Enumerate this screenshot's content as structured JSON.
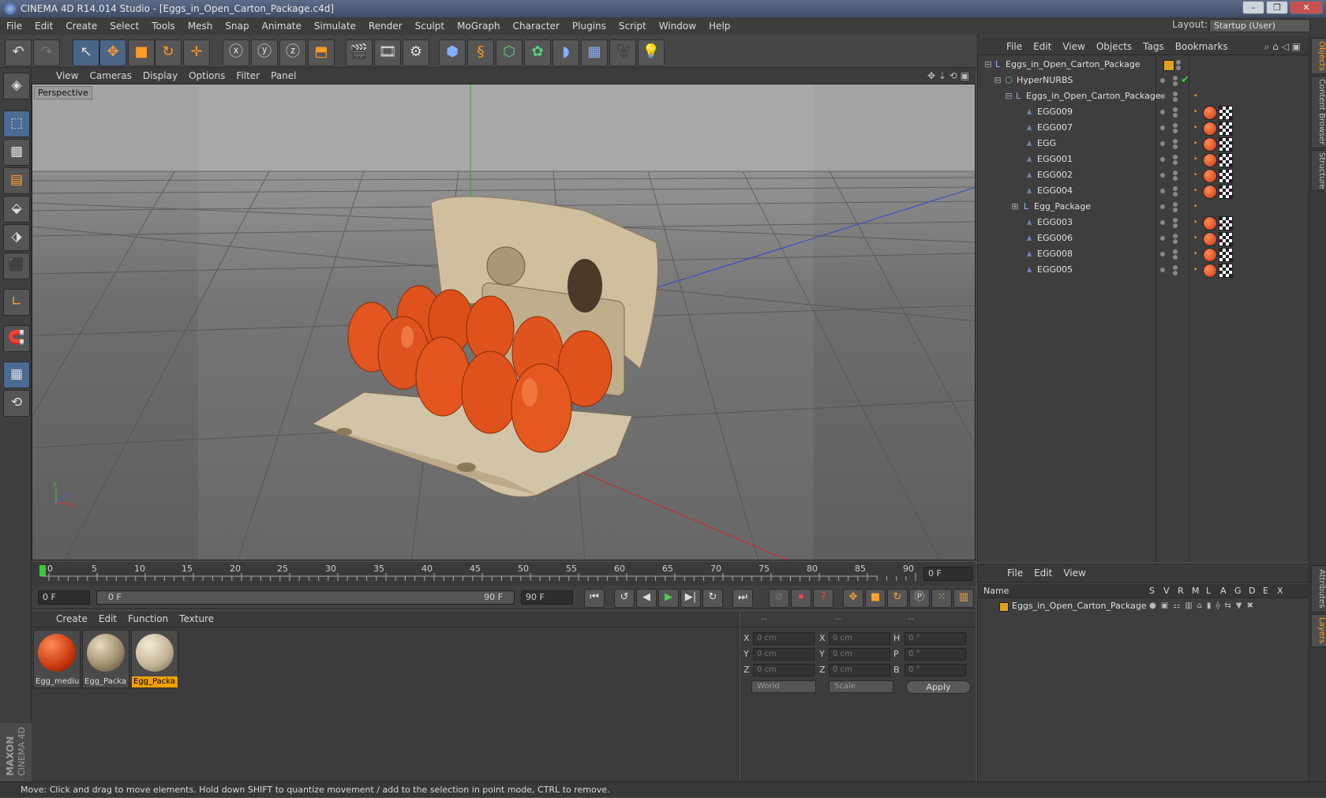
{
  "window": {
    "title": "CINEMA 4D R14.014 Studio - [Eggs_in_Open_Carton_Package.c4d]",
    "minimize": "–",
    "maximize": "❐",
    "close": "✕"
  },
  "menu": [
    "File",
    "Edit",
    "Create",
    "Select",
    "Tools",
    "Mesh",
    "Snap",
    "Animate",
    "Simulate",
    "Render",
    "Sculpt",
    "MoGraph",
    "Character",
    "Plugins",
    "Script",
    "Window",
    "Help"
  ],
  "layout": {
    "label": "Layout:",
    "value": "Startup (User)"
  },
  "viewport": {
    "menu": [
      "View",
      "Cameras",
      "Display",
      "Options",
      "Filter",
      "Panel"
    ],
    "label": "Perspective"
  },
  "timeline": {
    "ticks": [
      "0",
      "5",
      "10",
      "15",
      "20",
      "25",
      "30",
      "35",
      "40",
      "45",
      "50",
      "55",
      "60",
      "65",
      "70",
      "75",
      "80",
      "85",
      "90"
    ],
    "current_frame": "0 F",
    "start_field": "0 F",
    "range_start": "0 F",
    "range_end": "90 F",
    "end_field": "90 F"
  },
  "materials": {
    "menu": [
      "Create",
      "Edit",
      "Function",
      "Texture"
    ],
    "items": [
      {
        "name": "Egg_mediu",
        "selected": false
      },
      {
        "name": "Egg_Packa",
        "selected": false
      },
      {
        "name": "Egg_Packa",
        "selected": true
      }
    ]
  },
  "coords": {
    "headers": [
      "--",
      "--",
      "--"
    ],
    "rows": [
      {
        "l1": "X",
        "v1": "0 cm",
        "l2": "X",
        "v2": "0 cm",
        "l3": "H",
        "v3": "0 °"
      },
      {
        "l1": "Y",
        "v1": "0 cm",
        "l2": "Y",
        "v2": "0 cm",
        "l3": "P",
        "v3": "0 °"
      },
      {
        "l1": "Z",
        "v1": "0 cm",
        "l2": "Z",
        "v2": "0 cm",
        "l3": "B",
        "v3": "0 °"
      }
    ],
    "world": "World",
    "scale": "Scale",
    "apply": "Apply"
  },
  "objects": {
    "menu": [
      "File",
      "Edit",
      "View",
      "Objects",
      "Tags",
      "Bookmarks"
    ],
    "rows": [
      {
        "name": "Eggs_in_Open_Carton_Package",
        "indent": 0,
        "icon": "null"
      },
      {
        "name": "HyperNURBS",
        "indent": 1,
        "icon": "nurbs"
      },
      {
        "name": "Eggs_in_Open_Carton_Package",
        "indent": 2,
        "icon": "null"
      },
      {
        "name": "EGG009",
        "indent": 3,
        "icon": "poly"
      },
      {
        "name": "EGG007",
        "indent": 3,
        "icon": "poly"
      },
      {
        "name": "EGG",
        "indent": 3,
        "icon": "poly"
      },
      {
        "name": "EGG001",
        "indent": 3,
        "icon": "poly"
      },
      {
        "name": "EGG002",
        "indent": 3,
        "icon": "poly"
      },
      {
        "name": "EGG004",
        "indent": 3,
        "icon": "poly"
      },
      {
        "name": "Egg_Package",
        "indent": 3,
        "icon": "null"
      },
      {
        "name": "EGG003",
        "indent": 3,
        "icon": "poly"
      },
      {
        "name": "EGG006",
        "indent": 3,
        "icon": "poly"
      },
      {
        "name": "EGG008",
        "indent": 3,
        "icon": "poly"
      },
      {
        "name": "EGG005",
        "indent": 3,
        "icon": "poly"
      }
    ]
  },
  "layers": {
    "menu": [
      "File",
      "Edit",
      "View"
    ],
    "columns": [
      "Name",
      "S",
      "V",
      "R",
      "M",
      "L",
      "A",
      "G",
      "D",
      "E",
      "X"
    ],
    "row": "Eggs_in_Open_Carton_Package"
  },
  "sidetabs": [
    "Objects",
    "Content Browser",
    "Structure",
    "Attributes",
    "Layers"
  ],
  "status": "Move: Click and drag to move elements. Hold down SHIFT to quantize movement / add to the selection in point mode, CTRL to remove.",
  "colors": {
    "accent": "#f0a000",
    "egg": "#e0521c",
    "carton": "#d8c8a8"
  }
}
